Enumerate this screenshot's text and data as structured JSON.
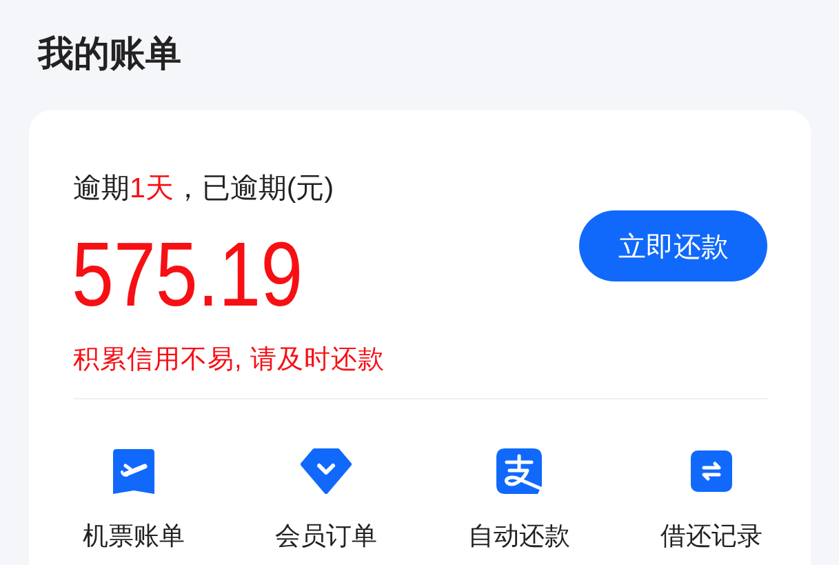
{
  "page": {
    "title": "我的账单"
  },
  "bill": {
    "status": [
      {
        "text": "逾期",
        "highlight": false
      },
      {
        "text": "1天",
        "highlight": true
      },
      {
        "text": "，已逾期(元)",
        "highlight": false
      }
    ],
    "amount": "575.19",
    "notice": "积累信用不易, 请及时还款",
    "pay_button": "立即还款"
  },
  "shortcuts": [
    {
      "label": "机票账单",
      "kind": "ticket"
    },
    {
      "label": "会员订单",
      "kind": "diamond"
    },
    {
      "label": "自动还款",
      "kind": "pay"
    },
    {
      "label": "借还记录",
      "kind": "transfer"
    }
  ]
}
